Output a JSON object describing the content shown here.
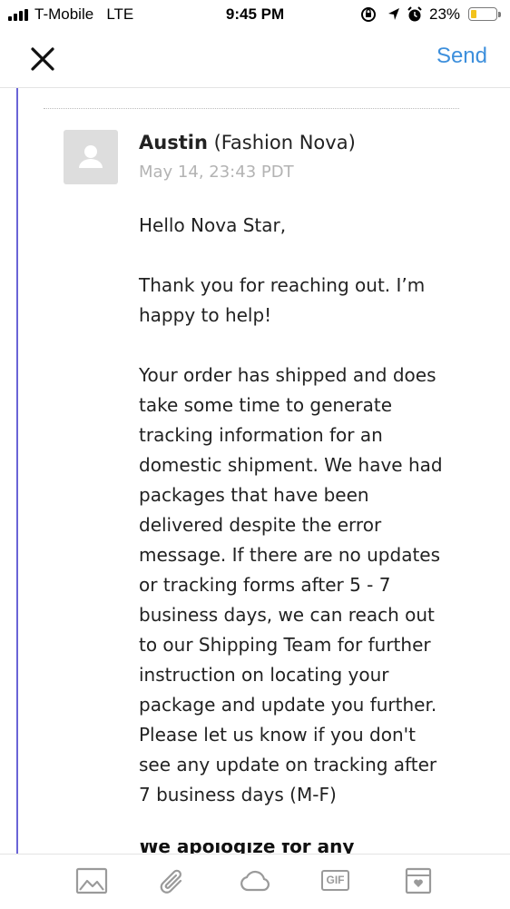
{
  "status_bar": {
    "carrier": "T-Mobile",
    "network": "LTE",
    "time": "9:45 PM",
    "battery_percent": "23%",
    "battery_level": 0.23,
    "icons": [
      "signal-icon",
      "screen-lock-rotation-icon",
      "location-arrow-icon",
      "alarm-icon",
      "battery-icon"
    ]
  },
  "nav": {
    "close_icon": "close-icon",
    "send_label": "Send",
    "accent_color": "#3d8fdc"
  },
  "message": {
    "quote_bar_color": "#6a64d6",
    "sender_name": "Austin",
    "sender_org": "(Fashion Nova)",
    "date": "May 14, 23:43 PDT",
    "paragraphs": [
      [
        "Hello Nova Star,"
      ],
      [
        "Thank you for reaching out. I’m",
        "happy to help!"
      ],
      [
        "Your order has shipped and does",
        "take some time to generate",
        "tracking information for an",
        "domestic shipment. We have had",
        "packages that have been",
        "delivered despite the error",
        "message. If there are no updates",
        "or tracking forms after 5 - 7",
        "business days, we can reach out",
        "to our Shipping Team for further",
        "instruction on locating your",
        "package and update you further.",
        "Please let us know if you don't",
        "see any update on tracking after",
        "7 business days (M-F)"
      ]
    ],
    "cut_off_text": "We apologize for any"
  },
  "toolbar": {
    "items": [
      "image-icon",
      "paperclip-icon",
      "cloud-icon",
      "gif-icon",
      "gift-card-icon"
    ],
    "gif_label": "GIF"
  }
}
